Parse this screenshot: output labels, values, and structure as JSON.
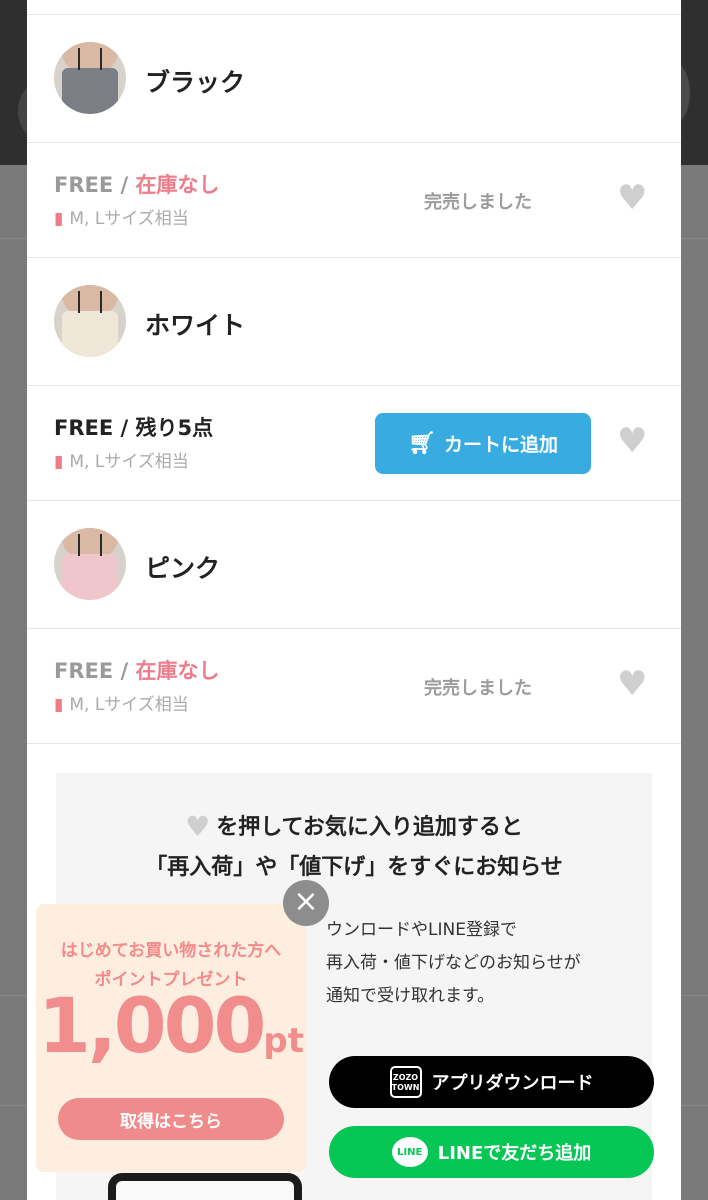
{
  "variants": [
    {
      "color_name": "ブラック",
      "size": "FREE",
      "stock": "在庫なし",
      "fit": "M, Lサイズ相当",
      "status": "完売しました",
      "in_stock": false,
      "thumb_color": "#7b7e84"
    },
    {
      "color_name": "ホワイト",
      "size": "FREE",
      "stock": "残り5点",
      "fit": "M, Lサイズ相当",
      "cart_label": "カートに追加",
      "in_stock": true,
      "thumb_color": "#eee6d6"
    },
    {
      "color_name": "ピンク",
      "size": "FREE",
      "stock": "在庫なし",
      "fit": "M, Lサイズ相当",
      "status": "完売しました",
      "in_stock": false,
      "thumb_color": "#efc6cc"
    }
  ],
  "separator": "/",
  "info": {
    "title_line1": "を押してお気に入り追加すると",
    "title_line2": "「再入荷」や「値下げ」をすぐにお知らせ",
    "text_line1": "ウンロードやLINE登録で",
    "text_line2": "再入荷・値下げなどのお知らせが",
    "text_line3": "通知で受け取れます。",
    "app_button": "アプリダウンロード",
    "app_logo_top": "ZOZO",
    "app_logo_bottom": "TOWN",
    "line_button": "LINEで友だち追加",
    "line_logo": "LINE"
  },
  "promo": {
    "line1": "はじめてお買い物された方へ",
    "line2": "ポイントプレゼント",
    "amount": "1,000",
    "unit": "pt",
    "button": "取得はこちら"
  },
  "colors": {
    "accent_blue": "#38ace0",
    "stock_out_pink": "#ee7d8c",
    "line_green": "#06c755",
    "promo_pink": "#f28d8d"
  }
}
